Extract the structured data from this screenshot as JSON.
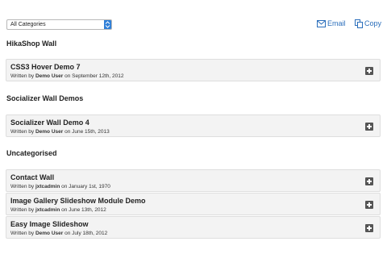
{
  "filter": {
    "selected": "All Categories"
  },
  "actions": {
    "email_label": "Email",
    "copy_label": "Copy",
    "accent": "#2a6ebb"
  },
  "sections": [
    {
      "title": "HikaShop Wall",
      "items": [
        {
          "title": "CSS3 Hover Demo 7",
          "written_by": "Written by",
          "author": "Demo User",
          "on": "on",
          "date": "September 12th, 2012"
        }
      ]
    },
    {
      "title": "Socializer Wall Demos",
      "items": [
        {
          "title": "Socializer Wall Demo 4",
          "written_by": "Written by",
          "author": "Demo User",
          "on": "on",
          "date": "June 15th, 2013"
        }
      ]
    },
    {
      "title": "Uncategorised",
      "items": [
        {
          "title": "Contact Wall",
          "written_by": "Written by",
          "author": "jxtcadmin",
          "on": "on",
          "date": "January 1st, 1970"
        },
        {
          "title": "Image Gallery Slideshow Module Demo",
          "written_by": "Written by",
          "author": "jxtcadmin",
          "on": "on",
          "date": "June 13th, 2012"
        },
        {
          "title": "Easy Image Slideshow",
          "written_by": "Written by",
          "author": "Demo User",
          "on": "on",
          "date": "July 18th, 2012"
        }
      ]
    }
  ],
  "icons": {
    "expand": "plus-square-icon",
    "email": "envelope-icon",
    "copy": "copy-icon",
    "dropdown": "chevron-updown-icon"
  }
}
